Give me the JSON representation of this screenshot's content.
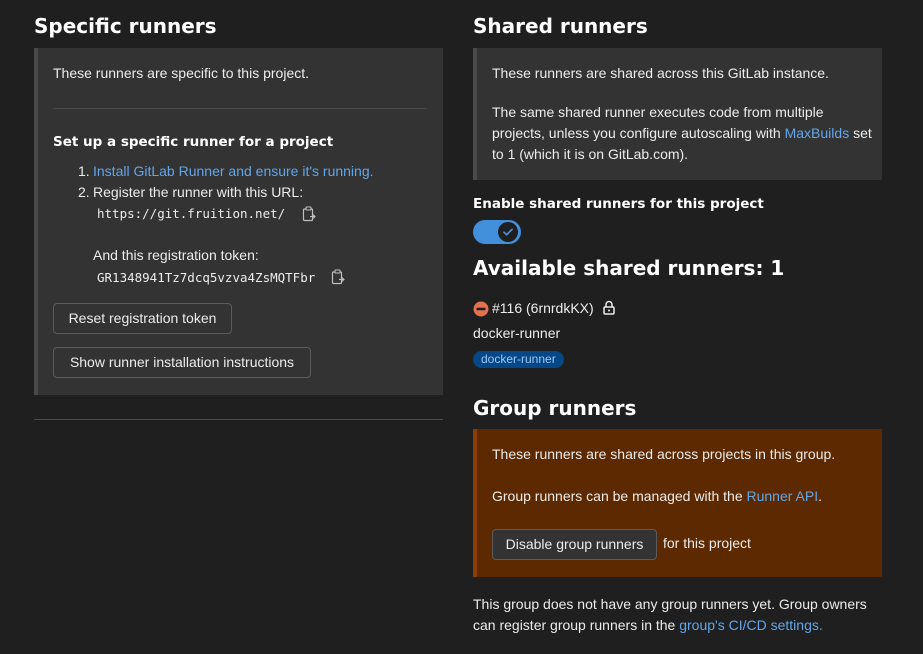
{
  "specific": {
    "title": "Specific runners",
    "intro": "These runners are specific to this project.",
    "setup_title": "Set up a specific runner for a project",
    "step1_num": "1.",
    "step1_link": "Install GitLab Runner and ensure it's running.",
    "step2_num": "2.",
    "step2_text": "Register the runner with this URL:",
    "url": "https://git.fruition.net/",
    "token_label": "And this registration token:",
    "token": "GR1348941Tz7dcq5vzva4ZsMQTFbr",
    "reset_button": "Reset registration token",
    "show_button": "Show runner installation instructions"
  },
  "shared": {
    "title": "Shared runners",
    "intro": "These runners are shared across this GitLab instance.",
    "desc_before": "The same shared runner executes code from multiple projects, unless you configure autoscaling with ",
    "desc_link": "MaxBuilds",
    "desc_after": " set to 1 (which it is on GitLab.com).",
    "enable_label": "Enable shared runners for this project",
    "toggle_on": true,
    "available_title": "Available shared runners: 1",
    "runner_id": "#116 (6rnrdkKX)",
    "runner_name": "docker-runner",
    "runner_tag": "docker-runner"
  },
  "group": {
    "title": "Group runners",
    "intro": "These runners are shared across projects in this group.",
    "manage_before": "Group runners can be managed with the ",
    "manage_link": "Runner API",
    "manage_after": ".",
    "disable_button": "Disable group runners",
    "disable_suffix": "for this project",
    "note_before": "This group does not have any group runners yet. Group owners can register group runners in the ",
    "note_link": "group's CI/CD settings.",
    "panel_color": "#5c2900"
  },
  "colors": {
    "accent": "#63a6e9",
    "toggle": "#428fdc",
    "tag_bg": "#064787",
    "danger": "#dd2b0e"
  }
}
